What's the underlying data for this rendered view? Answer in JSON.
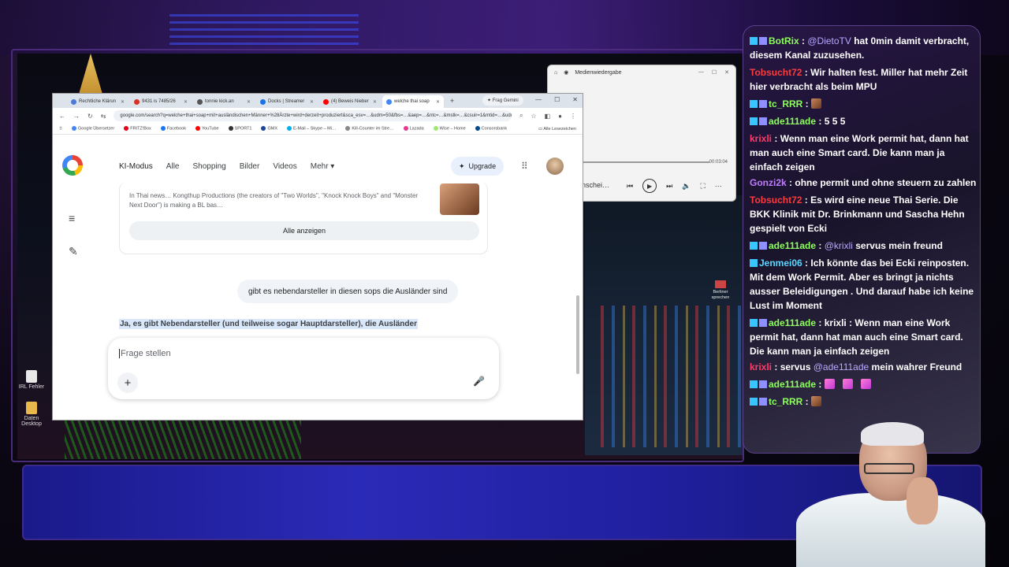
{
  "browser": {
    "tabs": [
      {
        "label": "Rechtliche Klärun",
        "color": "#4a7bd8"
      },
      {
        "label": "9431 is 7485/26",
        "color": "#d93025"
      },
      {
        "label": "tonnie kick.an",
        "color": "#555555"
      },
      {
        "label": "Docks | Streamer",
        "color": "#1a73e8"
      },
      {
        "label": "(4) Beweis Nieber",
        "color": "#ff0000"
      },
      {
        "label": "welche thai soap",
        "color": "#4285f4",
        "active": true
      }
    ],
    "tab_add": "+",
    "gemini_chip": "✦ Frag Gemini",
    "window_controls": [
      "—",
      "☐",
      "✕"
    ],
    "nav_buttons": [
      "←",
      "→",
      "↻",
      "⇆"
    ],
    "url": "google.com/search?q=welche+thai+soap+mit+ausländischen+Männer+%28Ärzte+wird+derzeit+produziert&sca_esv=…&udm=50&fbs=…&aep=…&ntc=…&mstk=…&csuir=1&mtid=…&udm=50&fbs=AlIPU_crgeCacg_ItnP&jpt=M4",
    "bookmarks": [
      "Google Übersetzer",
      "FRITZ!Box",
      "Facebook",
      "YouTube",
      "SPORT1",
      "GMX",
      "E-Mail – Skype – Mi…",
      "Kill-Counter im Stre…",
      "Lazada",
      "Wise – Home",
      "Consorsbank",
      "Alle Lesezeichen"
    ]
  },
  "google": {
    "nav": [
      "KI-Modus",
      "Alle",
      "Shopping",
      "Bilder",
      "Videos",
      "Mehr ▾"
    ],
    "upgrade_label": "Upgrade",
    "apps_icon": "⋮⋮⋮",
    "card_text": "In Thai news… Kongthup Productions (the creators of \"Two Worlds\", \"Knock Knock Boys\" and \"Monster Next Door\") is making a BL bas…",
    "show_all": "Alle anzeigen",
    "user_message": "gibt es nebendarsteller in diesen sops die Ausländer sind",
    "answer_start": "Ja, es gibt Nebendarsteller (und teilweise sogar Hauptdarsteller), die Ausländer",
    "input_placeholder": "Frage stellen",
    "plus": "+",
    "mic": "🎙"
  },
  "player": {
    "title": "Medienwiedergabe",
    "time": "00:03:04",
    "name": "enschei…",
    "controls": [
      "⏮",
      "▶",
      "⏭",
      "🔈",
      "⛶",
      "⋯"
    ]
  },
  "desktop": {
    "icons": [
      {
        "label": "IRL Fehler"
      },
      {
        "label": "Daten Desktop"
      }
    ],
    "rec_note": "Berliner sprechen"
  },
  "chat": {
    "colors": {
      "botrix": "#8cff5a",
      "tobsucht72": "#ff3b3b",
      "tc_rrr": "#8cff5a",
      "ade111ade": "#8cff5a",
      "krixli": "#ff3b6b",
      "gonzi2k": "#c07cff",
      "jenmei06": "#5ad7ff",
      "mention": "#b9a8ff"
    },
    "messages": [
      {
        "user": "BotRix",
        "color": "#8cff5a",
        "badges": 2,
        "parts": [
          {
            "t": "@DietoTV",
            "m": true
          },
          {
            "t": " hat 0min damit verbracht, diesem Kanal zuzusehen."
          }
        ]
      },
      {
        "user": "Tobsucht72",
        "color": "#ff3b3b",
        "badges": 0,
        "parts": [
          {
            "t": "Wir halten fest. Miller hat mehr Zeit hier verbracht als beim MPU"
          }
        ]
      },
      {
        "user": "tc_RRR",
        "color": "#8cff5a",
        "badges": 2,
        "parts": [],
        "emotes": 1
      },
      {
        "user": "ade111ade",
        "color": "#8cff5a",
        "badges": 2,
        "parts": [
          {
            "t": "5 5 5"
          }
        ]
      },
      {
        "user": "krixli",
        "color": "#ff3b6b",
        "badges": 0,
        "parts": [
          {
            "t": "Wenn man eine Work permit hat, dann hat man auch eine Smart card. Die kann man ja einfach zeigen"
          }
        ]
      },
      {
        "user": "Gonzi2k",
        "color": "#c07cff",
        "badges": 0,
        "parts": [
          {
            "t": "ohne permit und ohne steuern zu zahlen"
          }
        ]
      },
      {
        "user": "Tobsucht72",
        "color": "#ff3b3b",
        "badges": 0,
        "parts": [
          {
            "t": "Es wird eine neue Thai Serie. Die BKK Klinik mit Dr. Brinkmann und Sascha Hehn gespielt von Ecki"
          }
        ]
      },
      {
        "user": "ade111ade",
        "color": "#8cff5a",
        "badges": 2,
        "parts": [
          {
            "t": "@krixli",
            "m": true
          },
          {
            "t": " servus mein freund"
          }
        ]
      },
      {
        "user": "Jenmei06",
        "color": "#5ad7ff",
        "badges": 1,
        "parts": [
          {
            "t": "Ich könnte das bei Ecki reinposten. Mit dem Work Permit. Aber es bringt ja nichts ausser Beleidigungen . Und darauf habe ich keine Lust im Moment"
          }
        ]
      },
      {
        "user": "ade111ade",
        "color": "#8cff5a",
        "badges": 2,
        "parts": [
          {
            "t": "krixli : Wenn man eine Work permit hat, dann hat man auch eine Smart card. Die kann man ja einfach zeigen"
          }
        ]
      },
      {
        "user": "krixli",
        "color": "#ff3b6b",
        "badges": 0,
        "parts": [
          {
            "t": "servus "
          },
          {
            "t": "@ade111ade",
            "m": true
          },
          {
            "t": " mein wahrer Freund"
          }
        ]
      },
      {
        "user": "ade111ade",
        "color": "#8cff5a",
        "badges": 2,
        "parts": [],
        "emotes": 3
      },
      {
        "user": "tc_RRR",
        "color": "#8cff5a",
        "badges": 2,
        "parts": [],
        "emotes": 1
      }
    ]
  }
}
